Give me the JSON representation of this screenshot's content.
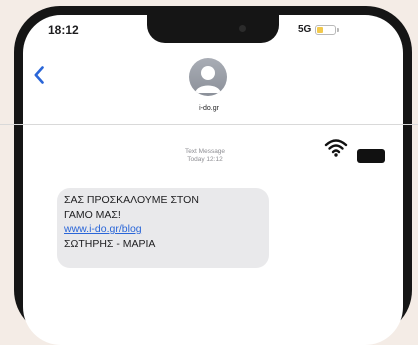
{
  "status_bar": {
    "time": "18:12",
    "network": "5G"
  },
  "conversation": {
    "contact_name": "i-do.gr"
  },
  "thread": {
    "label": "Text Message",
    "timestamp": "Today 12:12"
  },
  "message": {
    "lines": [
      "ΣΑΣ ΠΡΟΣΚΑΛΟΥΜΕ ΣΤΟΝ",
      "ΓΑΜΟ ΜΑΣ!"
    ],
    "link": "www.i-do.gr/blog",
    "signature": "ΣΩΤΗΡΗΣ - ΜΑΡΙΑ"
  },
  "icons": {
    "back": "chevron-left-icon",
    "avatar": "contact-avatar-icon",
    "wifi": "wifi-icon",
    "battery": "battery-icon"
  },
  "colors": {
    "accent": "#2a66d8",
    "bubble": "#e9e9eb",
    "frame": "#151515",
    "background": "#f4ece6"
  }
}
